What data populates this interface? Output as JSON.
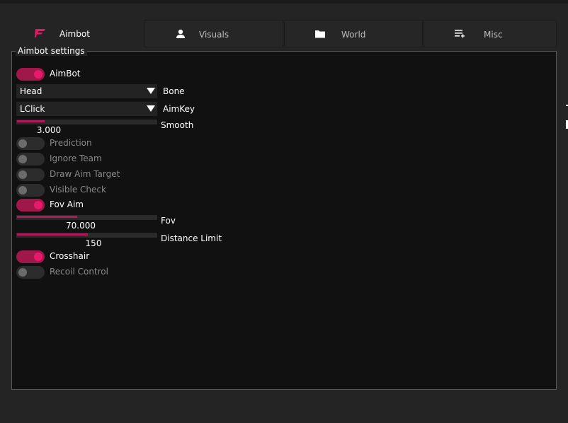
{
  "tabs": [
    {
      "label": "Aimbot",
      "icon": "aimbot-icon",
      "active": true
    },
    {
      "label": "Visuals",
      "icon": "person-icon",
      "active": false
    },
    {
      "label": "World",
      "icon": "folder-icon",
      "active": false
    },
    {
      "label": "Misc",
      "icon": "playlist-add-icon",
      "active": false
    }
  ],
  "group": {
    "title": "Aimbot settings"
  },
  "settings": {
    "aimbot": {
      "label": "AimBot",
      "enabled": true
    },
    "bone": {
      "value": "Head",
      "label": "Bone"
    },
    "aimkey": {
      "value": "LClick",
      "label": "AimKey"
    },
    "smooth": {
      "label": "Smooth",
      "value": "3.000",
      "fill": 0.2
    },
    "prediction": {
      "label": "Prediction",
      "enabled": false
    },
    "ignore_team": {
      "label": "Ignore Team",
      "enabled": false
    },
    "draw_aim_target": {
      "label": "Draw Aim Target",
      "enabled": false
    },
    "visible_check": {
      "label": "Visible Check",
      "enabled": false
    },
    "fov_aim": {
      "label": "Fov Aim",
      "enabled": true
    },
    "fov": {
      "label": "Fov",
      "value": "70.000",
      "fill": 0.43
    },
    "distance_limit": {
      "label": "Distance Limit",
      "value": "150",
      "fill": 0.51
    },
    "crosshair": {
      "label": "Crosshair",
      "enabled": true
    },
    "recoil_control": {
      "label": "Recoil Control",
      "enabled": false
    }
  },
  "colors": {
    "accent": "#e8186a",
    "toggle_on": "#a0174a",
    "panel_bg": "#111111",
    "window_bg": "#242424"
  }
}
